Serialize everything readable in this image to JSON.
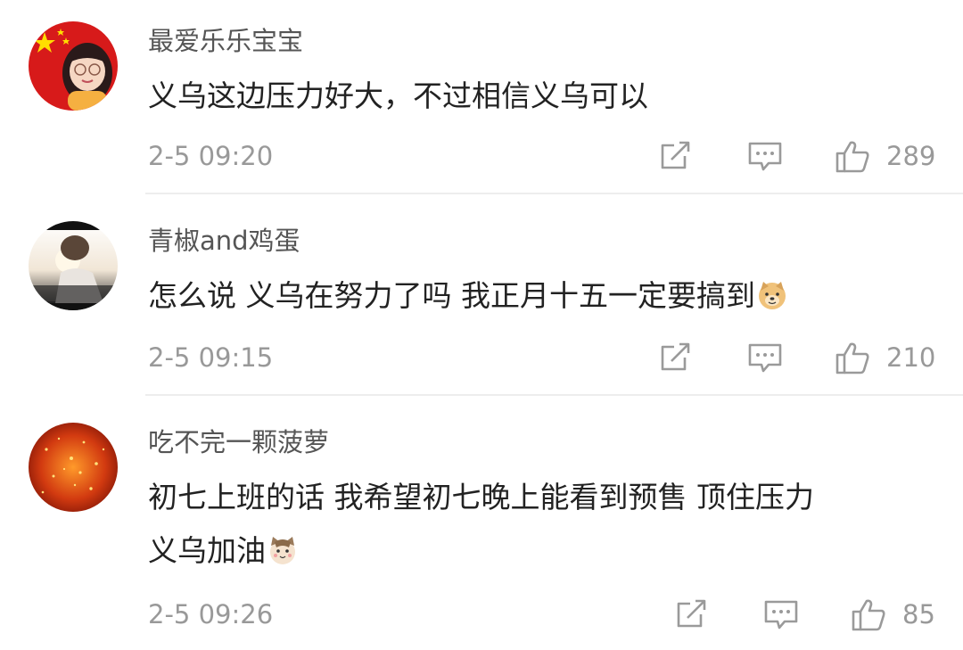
{
  "comments": [
    {
      "username": "最爱乐乐宝宝",
      "text": "义乌这边压力好大，不过相信义乌可以",
      "time": "2-5 09:20",
      "likes": "289",
      "avatar_icon": "flag-girl-avatar"
    },
    {
      "username": "青椒and鸡蛋",
      "text": "怎么说 义乌在努力了吗 我正月十五一定要搞到",
      "emoji": "doge-emoji",
      "time": "2-5 09:15",
      "likes": "210",
      "avatar_icon": "sunset-photo-avatar"
    },
    {
      "username": "吃不完一颗菠萝",
      "text_line1": "初七上班的话  我希望初七晚上能看到预售 顶住压力",
      "text_line2": "义乌加油",
      "emoji": "cat-emoji",
      "time": "2-5 09:26",
      "likes": "85",
      "avatar_icon": "red-glitter-avatar"
    }
  ],
  "icons": {
    "repost": "repost-icon",
    "comment": "comment-icon",
    "like": "thumbs-up-icon"
  },
  "colors": {
    "username": "#555555",
    "text": "#222222",
    "meta": "#999999",
    "divider": "#ededed"
  }
}
